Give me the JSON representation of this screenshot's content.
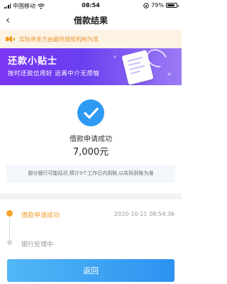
{
  "status_bar": {
    "carrier": "中国移动",
    "time": "08:54",
    "battery": "79%",
    "battery_level": 0.79
  },
  "nav": {
    "back_icon": "‹",
    "title": "借款结果"
  },
  "notice": {
    "icon": "speaker-icon",
    "text": "实际资金方由最终放款机构为准"
  },
  "banner": {
    "title": "还款小贴士",
    "subtitle": "按时还款信用好  远离中介无烦恼"
  },
  "result": {
    "icon": "check-circle-icon",
    "title": "借款申请成功",
    "amount": "7,000元",
    "note": "部分银行可能延迟,预计3个工作日内到账,以实际到账为准"
  },
  "timeline": [
    {
      "label": "借款申请成功",
      "time": "2020-10-11 08:54:36",
      "state": "active"
    },
    {
      "label": "银行处理中",
      "time": "",
      "state": "inactive"
    }
  ],
  "colors": {
    "accent_blue": "#2f9af4",
    "accent_orange": "#f19a2b",
    "banner_purple": "#7a36f2"
  },
  "footer": {
    "back_label": "返回"
  }
}
